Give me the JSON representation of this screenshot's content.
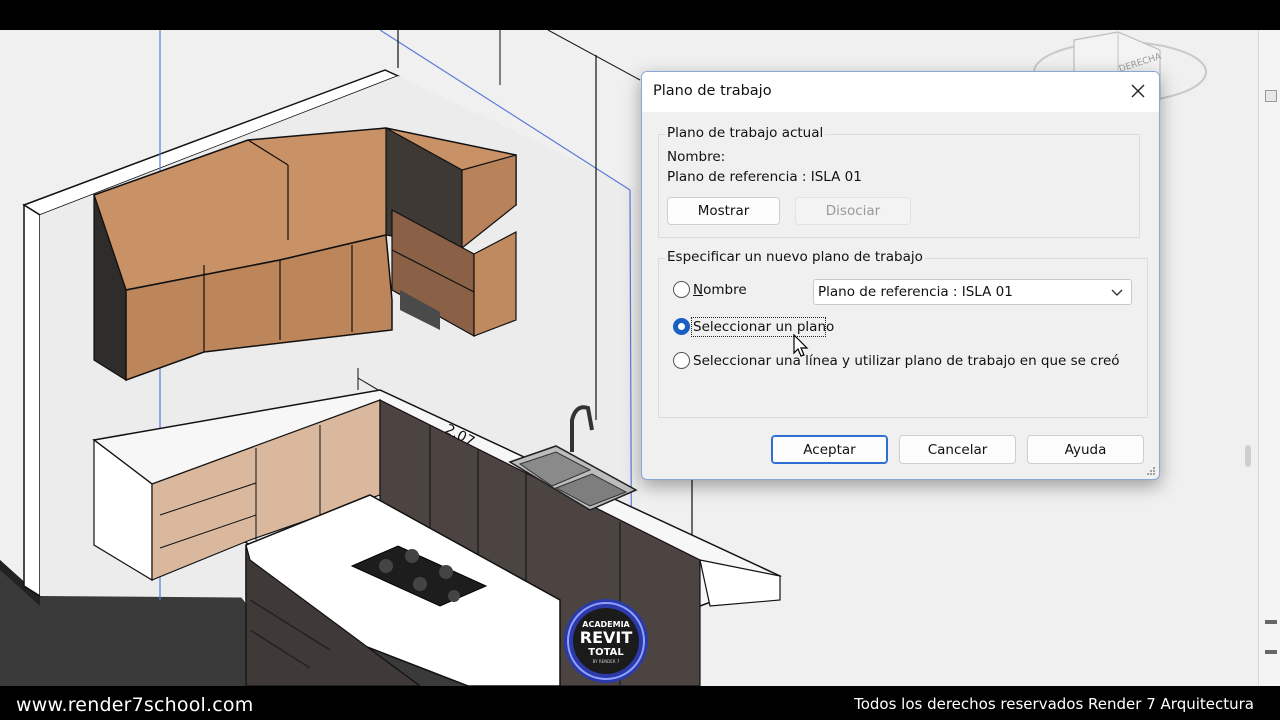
{
  "dialog": {
    "title": "Plano de trabajo",
    "current_group_label": "Plano de trabajo actual",
    "name_label": "Nombre:",
    "reference_text": "Plano de referencia : ISLA 01",
    "show_button": "Mostrar",
    "dissociate_button": "Disociar",
    "specify_group_label": "Especificar un nuevo plano de trabajo",
    "options": [
      {
        "label_prefix": "",
        "label_underlined": "N",
        "label_rest": "ombre",
        "selected": false
      },
      {
        "label": "Seleccionar un plano",
        "selected": true
      },
      {
        "label": "Seleccionar una línea y utilizar plano de trabajo en que se creó",
        "selected": false
      }
    ],
    "name_select_value": "Plano de referencia : ISLA 01",
    "ok_button": "Aceptar",
    "cancel_button": "Cancelar",
    "help_button": "Ayuda"
  },
  "viewport": {
    "dimension_label": "2.07",
    "viewcube_label": "DERECHA"
  },
  "logo": {
    "line1": "ACADEMIA",
    "line2": "REVIT",
    "line3": "TOTAL",
    "line4": "BY RENDER 7"
  },
  "footer": {
    "site": "www.render7school.com",
    "rights": "Todos los derechos reservados Render 7 Arquitectura"
  },
  "colors": {
    "accent": "#1a5fc4",
    "wood": "#c38a5e",
    "dark_cabinet": "#4b4440"
  },
  "icons": {
    "close": "close-icon",
    "chevron": "chevron-down-icon",
    "cursor": "mouse-cursor-icon",
    "grip": "resize-grip-icon"
  }
}
